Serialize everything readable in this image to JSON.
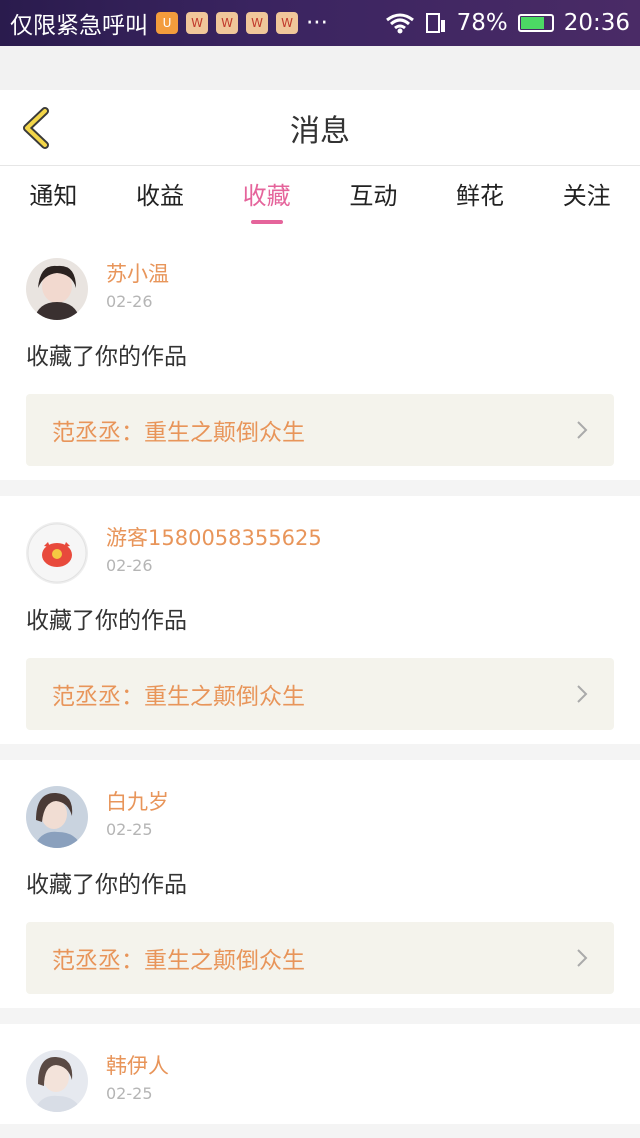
{
  "status_bar": {
    "left_text": "仅限紧急呼叫",
    "more": "···",
    "battery": "78%",
    "time": "20:36",
    "battery_level": 0.78
  },
  "header": {
    "title": "消息"
  },
  "tabs": [
    {
      "label": "通知",
      "active": false
    },
    {
      "label": "收益",
      "active": false
    },
    {
      "label": "收藏",
      "active": true
    },
    {
      "label": "互动",
      "active": false
    },
    {
      "label": "鲜花",
      "active": false
    },
    {
      "label": "关注",
      "active": false
    }
  ],
  "items": [
    {
      "username": "苏小温",
      "date": "02-26",
      "action": "收藏了你的作品",
      "work": "范丞丞：重生之颠倒众生"
    },
    {
      "username": "游客1580058355625",
      "date": "02-26",
      "action": "收藏了你的作品",
      "work": "范丞丞：重生之颠倒众生"
    },
    {
      "username": "白九岁",
      "date": "02-25",
      "action": "收藏了你的作品",
      "work": "范丞丞：重生之颠倒众生"
    },
    {
      "username": "韩伊人",
      "date": "02-25"
    }
  ],
  "colors": {
    "accent": "#e5649b",
    "name": "#e8955a",
    "link_bg": "#f4f3ec"
  }
}
